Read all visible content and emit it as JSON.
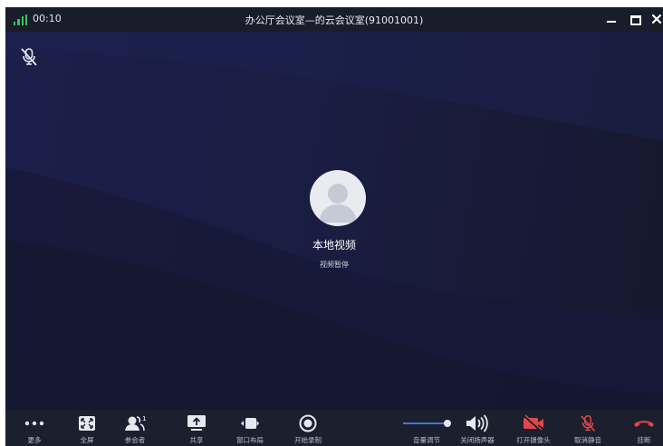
{
  "titlebar": {
    "timer": "00:10",
    "title": "办公厅会议室—的云会议室(91001001)",
    "signal_icon": "signal-bars-icon",
    "signal_color": "#36c25a"
  },
  "video": {
    "local_label": "本地视频",
    "status_label": "视频暂停",
    "mic_state_icon": "mic-off-icon"
  },
  "toolbar": {
    "more": "更多",
    "fullscreen": "全屏",
    "participants": "参会者",
    "participants_count": "1",
    "share": "共享",
    "layout": "窗口布局",
    "record": "开始录制",
    "volume": "音量调节",
    "speaker": "关闭扬声器",
    "camera": "打开摄像头",
    "unmute": "取消静音",
    "hangup": "挂断"
  },
  "colors": {
    "background": "#16192e",
    "toolbar": "#1c1f2e",
    "accent": "#3a7bd5",
    "danger": "#e04848"
  }
}
